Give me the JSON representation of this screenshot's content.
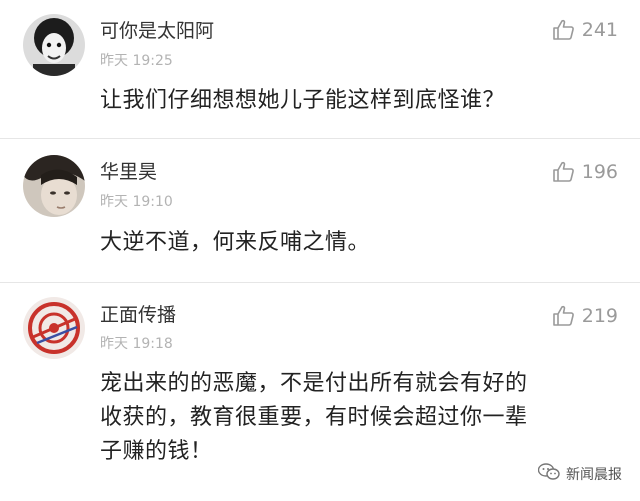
{
  "comments": [
    {
      "username": "可你是太阳阿",
      "time": "昨天 19:25",
      "likes": "241",
      "content": "让我们仔细想想她儿子能这样到底怪谁？"
    },
    {
      "username": "华里昊",
      "time": "昨天 19:10",
      "likes": "196",
      "content": "大逆不道，何来反哺之情。"
    },
    {
      "username": "正面传播",
      "time": "昨天 19:18",
      "likes": "219",
      "content_lines": [
        "宠出来的的恶魔，不是付出所有就会有好的",
        "收获的，教育很重要，有时候会超过你一辈",
        "子赚的钱！"
      ]
    }
  ],
  "watermark": {
    "text": "新闻晨报",
    "icon": "wechat-icon"
  },
  "icons": {
    "like": "thumbs-up-icon"
  }
}
